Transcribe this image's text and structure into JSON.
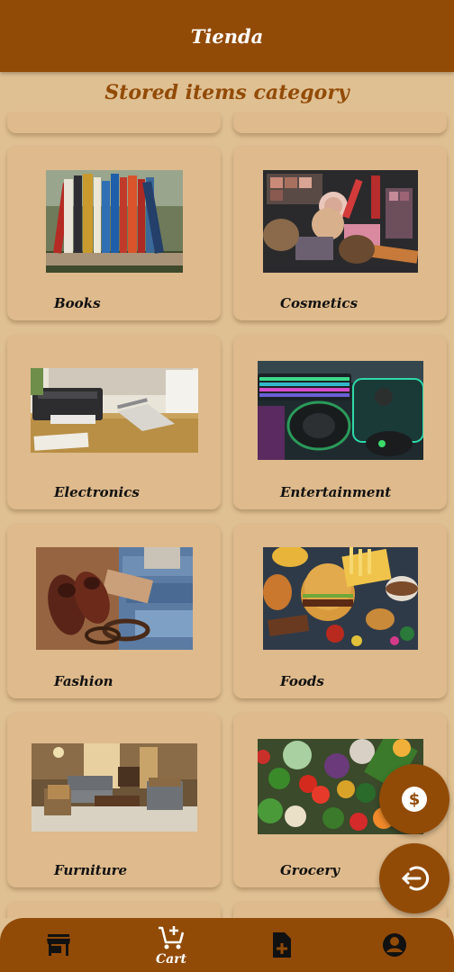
{
  "app": {
    "title": "Tienda"
  },
  "page": {
    "section_title": "Stored items category"
  },
  "categories": [
    {
      "label": "Books",
      "image": "books-photo"
    },
    {
      "label": "Cosmetics",
      "image": "cosmetics-photo"
    },
    {
      "label": "Electronics",
      "image": "electronics-photo"
    },
    {
      "label": "Entertainment",
      "image": "entertainment-photo"
    },
    {
      "label": "Fashion",
      "image": "fashion-photo"
    },
    {
      "label": "Foods",
      "image": "foods-photo"
    },
    {
      "label": "Furniture",
      "image": "furniture-photo"
    },
    {
      "label": "Grocery",
      "image": "grocery-photo"
    }
  ],
  "fabs": {
    "top_icon": "dollar-icon",
    "bottom_icon": "logout-icon"
  },
  "bottom_nav": {
    "items": [
      {
        "icon": "store-icon",
        "label": ""
      },
      {
        "icon": "add-cart-icon",
        "label": "Cart"
      },
      {
        "icon": "add-document-icon",
        "label": ""
      },
      {
        "icon": "account-icon",
        "label": ""
      }
    ]
  },
  "colors": {
    "primary": "#924b07",
    "background": "#dfc093",
    "card": "#deba8c"
  }
}
